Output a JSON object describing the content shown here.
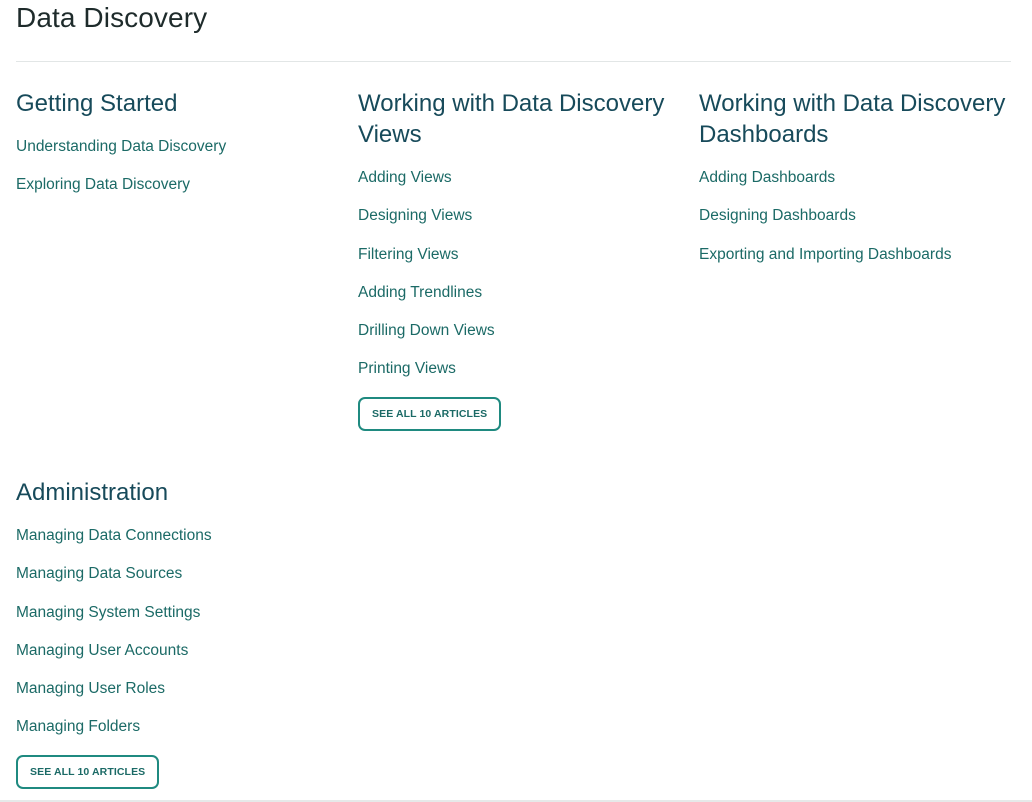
{
  "page": {
    "title": "Data Discovery"
  },
  "sections": [
    {
      "title": "Getting Started",
      "articles": [
        "Understanding Data Discovery",
        "Exploring Data Discovery"
      ]
    },
    {
      "title": "Working with Data Discovery Views",
      "articles": [
        "Adding Views",
        "Designing Views",
        "Filtering Views",
        "Adding Trendlines",
        "Drilling Down Views",
        "Printing Views"
      ],
      "see_all_label": "SEE ALL 10 ARTICLES"
    },
    {
      "title": "Working with Data Discovery Dashboards",
      "articles": [
        "Adding Dashboards",
        "Designing Dashboards",
        "Exporting and Importing Dashboards"
      ]
    },
    {
      "title": "Administration",
      "articles": [
        "Managing Data Connections",
        "Managing Data Sources",
        "Managing System Settings",
        "Managing User Accounts",
        "Managing User Roles",
        "Managing Folders"
      ],
      "see_all_label": "SEE ALL 10 ARTICLES"
    }
  ],
  "colors": {
    "heading": "#174a5a",
    "link": "#1b6a66",
    "button_border": "#1f8a80"
  }
}
